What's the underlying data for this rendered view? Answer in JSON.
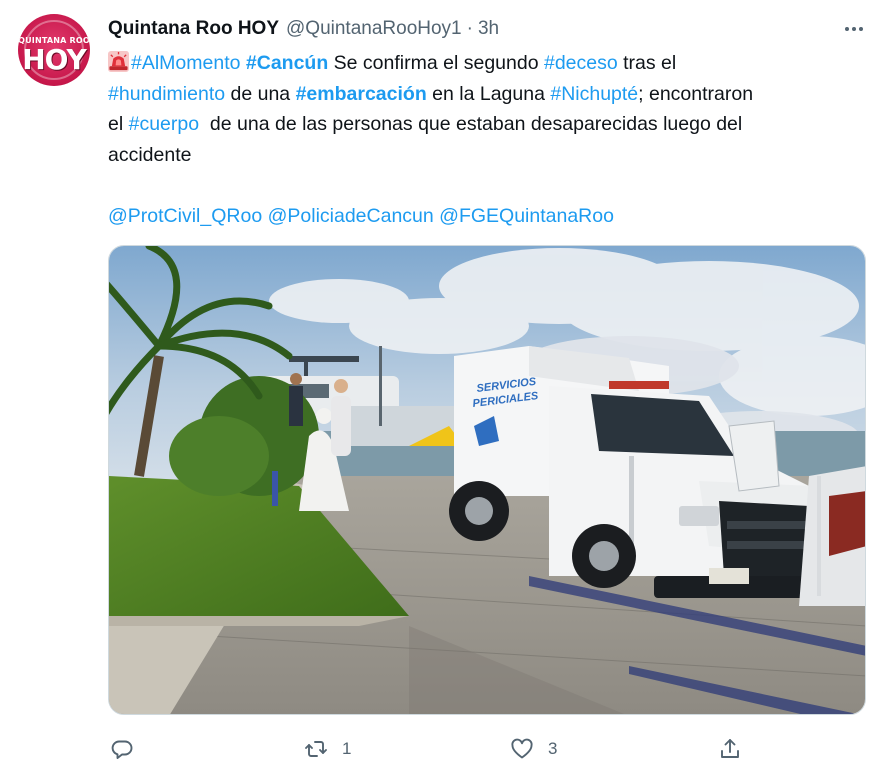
{
  "account": {
    "avatar_small_text": "QUINTANA ROO",
    "avatar_big_text": "HOY",
    "display_name": "Quintana Roo HOY",
    "handle": "@QuintanaRooHoy1",
    "separator": "·",
    "time": "3h"
  },
  "tweet": {
    "line1": {
      "tag_almomento": "#AlMomento",
      "tag_cancun": "#Cancún",
      "t1": " Se confirma el segundo ",
      "tag_deceso": "#deceso",
      "t2": " tras el"
    },
    "line2": {
      "tag_hundimiento": "#hundimiento",
      "t1": " de una ",
      "tag_embarcacion": "#embarcación",
      "t2": " en la Laguna ",
      "tag_nichupte": "#Nichupté",
      "t3": "; encontraron"
    },
    "line3": {
      "t0": "el ",
      "tag_cuerpo": "#cuerpo",
      "t1": "  de una de las personas que estaban desaparecidas luego del"
    },
    "line4": "accidente",
    "mentions": [
      "@ProtCivil_QRoo",
      "@PoliciadeCancun",
      "@FGEQuintanaRoo"
    ]
  },
  "photo": {
    "van_label_line1": "SERVICIOS",
    "van_label_line2": "PERICIALES"
  },
  "actions": {
    "reply_count": "",
    "retweet_count": "1",
    "like_count": "3"
  },
  "colors": {
    "link": "#1d9bf0",
    "secondary_text": "#536471",
    "primary_text": "#0f1419",
    "avatar_bg": "#c6174a"
  },
  "icons": [
    "siren-emoji-icon",
    "more-icon",
    "reply-icon",
    "retweet-icon",
    "like-icon",
    "share-icon"
  ]
}
